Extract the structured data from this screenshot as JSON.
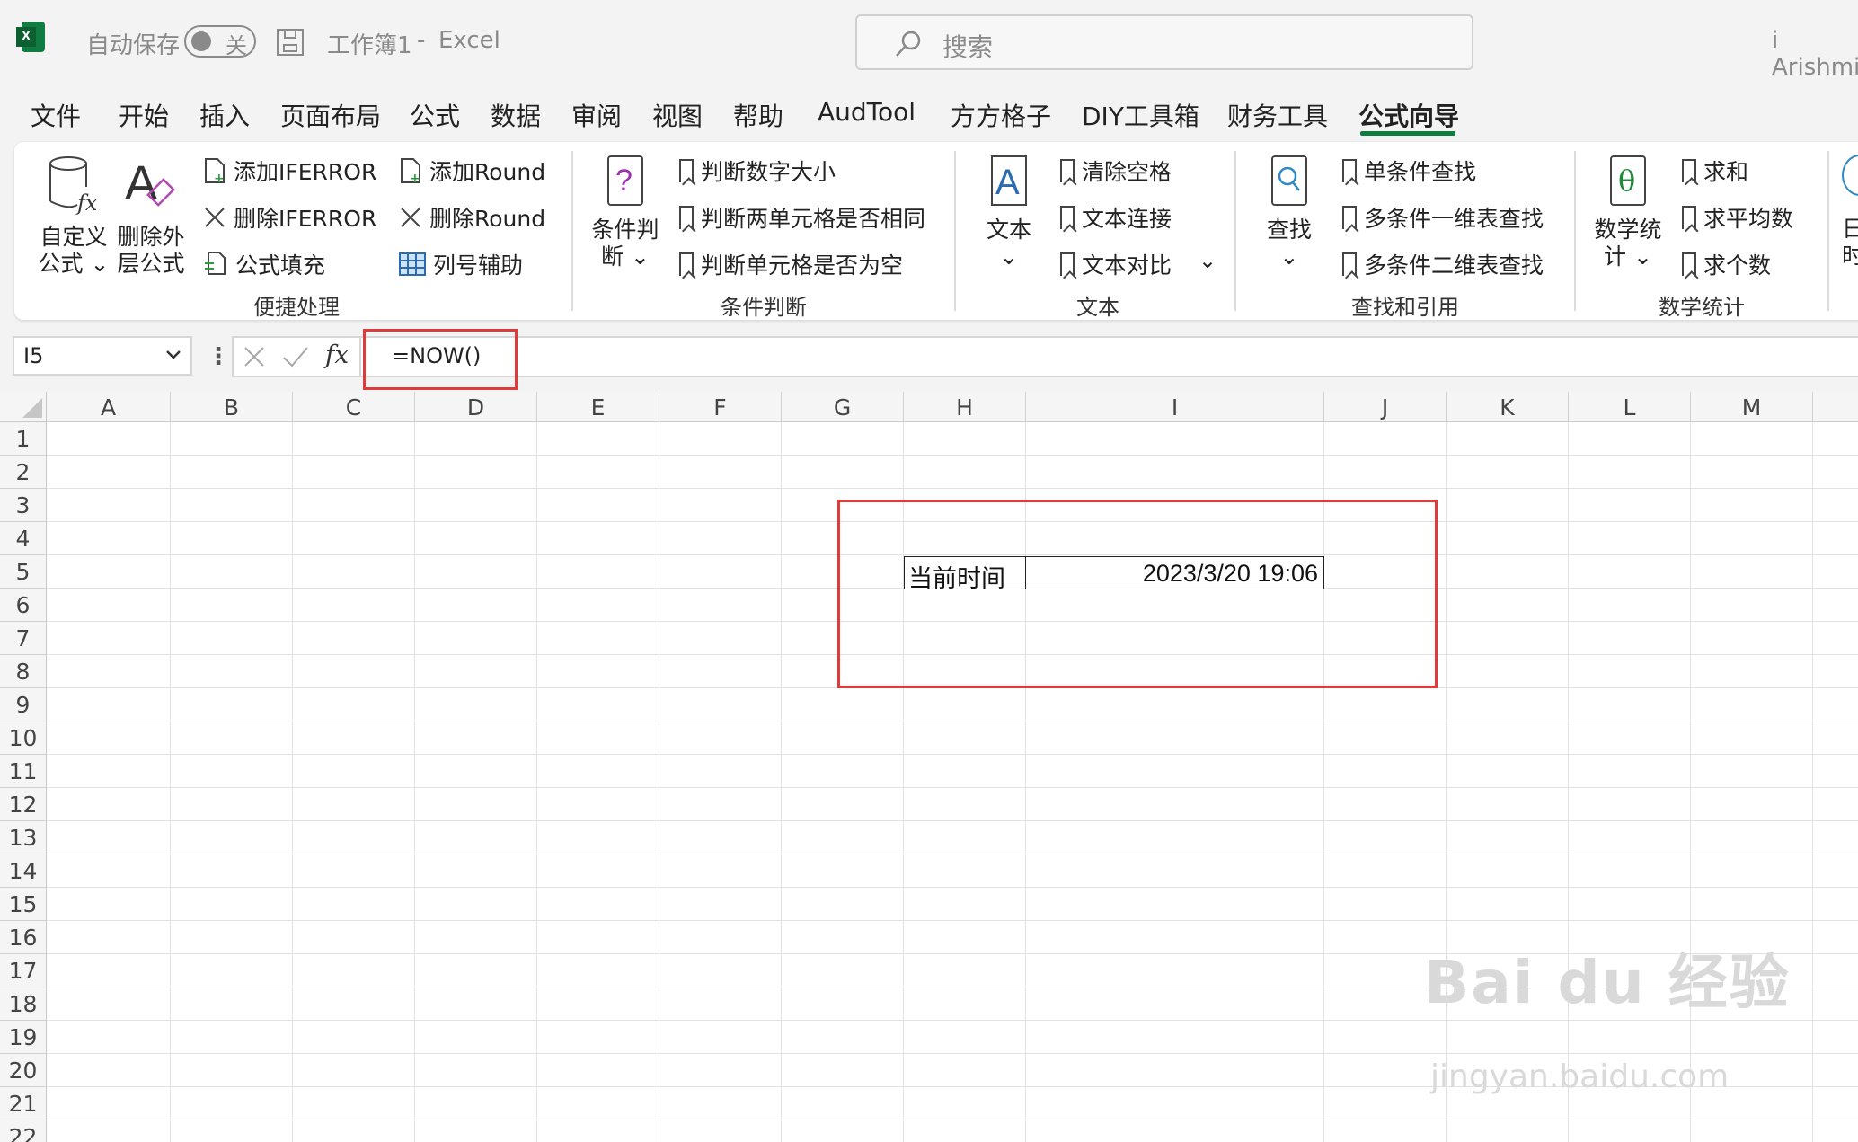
{
  "titlebar": {
    "autosave_label": "自动保存",
    "autosave_state": "关",
    "doc_title": "工作簿1",
    "sep": "-",
    "app_name": "Excel",
    "search_placeholder": "搜索",
    "user": "i Arishmi"
  },
  "tabs": [
    "文件",
    "开始",
    "插入",
    "页面布局",
    "公式",
    "数据",
    "审阅",
    "视图",
    "帮助",
    "AudTool",
    "方方格子",
    "DIY工具箱",
    "财务工具",
    "公式向导"
  ],
  "active_tab": "公式向导",
  "ribbon": {
    "quick": {
      "custom_formula": [
        "自定义",
        "公式 ⌄"
      ],
      "delete_outer": [
        "删除外",
        "层公式"
      ],
      "add_iferror": "添加IFERROR",
      "del_iferror": "删除IFERROR",
      "formula_fill": "公式填充",
      "add_round": "添加Round",
      "del_round": "删除Round",
      "col_helper": "列号辅助",
      "group": "便捷处理"
    },
    "cond": {
      "big": [
        "条件判",
        "断 ⌄"
      ],
      "items": [
        "判断数字大小",
        "判断两单元格是否相同",
        "判断单元格是否为空"
      ],
      "group": "条件判断"
    },
    "text": {
      "big": [
        "文本",
        "⌄"
      ],
      "items": [
        "清除空格",
        "文本连接",
        "文本对比"
      ],
      "more": "⌄",
      "group": "文本"
    },
    "lookup": {
      "big": [
        "查找",
        "⌄"
      ],
      "items": [
        "单条件查找",
        "多条件一维表查找",
        "多条件二维表查找"
      ],
      "group": "查找和引用"
    },
    "math": {
      "big": [
        "数学统",
        "计 ⌄"
      ],
      "items": [
        "求和",
        "求平均数",
        "求个数"
      ],
      "group": "数学统计"
    },
    "cut": [
      "日",
      "时"
    ]
  },
  "formula_bar": {
    "name_box": "I5",
    "formula": "=NOW()",
    "fx": "fx"
  },
  "sheet": {
    "columns": [
      "A",
      "B",
      "C",
      "D",
      "E",
      "F",
      "G",
      "H",
      "I",
      "J",
      "K",
      "L",
      "M"
    ],
    "rows": [
      "1",
      "2",
      "3",
      "4",
      "5",
      "6",
      "7",
      "8",
      "9",
      "10",
      "11",
      "12",
      "13",
      "14",
      "15",
      "16",
      "17",
      "18",
      "19",
      "20",
      "21",
      "22"
    ],
    "h5": "当前时间",
    "i5": "2023/3/20 19:06"
  },
  "watermark": {
    "main": "Bai du 经验",
    "sub": "jingyan.baidu.com"
  },
  "colors": {
    "excel_green": "#107c41",
    "highlight_red": "#e03b3b"
  }
}
